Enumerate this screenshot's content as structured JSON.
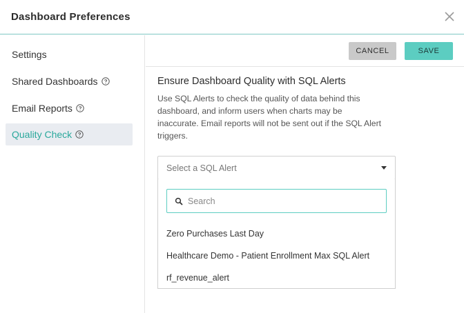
{
  "dialog": {
    "title": "Dashboard Preferences"
  },
  "sidebar": {
    "items": [
      {
        "label": "Settings",
        "has_help": false
      },
      {
        "label": "Shared Dashboards",
        "has_help": true
      },
      {
        "label": "Email Reports",
        "has_help": true
      },
      {
        "label": "Quality Check",
        "has_help": true,
        "active": true
      }
    ]
  },
  "toolbar": {
    "cancel_label": "CANCEL",
    "save_label": "SAVE"
  },
  "main": {
    "heading": "Ensure Dashboard Quality with SQL Alerts",
    "description": "Use SQL Alerts to check the quality of data behind this dashboard, and inform users when charts may be inaccurate. Email reports will not be sent out if the SQL Alert triggers.",
    "select": {
      "placeholder": "Select a SQL Alert",
      "search_placeholder": "Search",
      "options": [
        "Zero Purchases Last Day",
        "Healthcare Demo - Patient Enrollment Max SQL Alert",
        "rf_revenue_alert"
      ]
    }
  },
  "colors": {
    "accent": "#5ccdc1",
    "active_text": "#2aa89c",
    "active_bg": "#e9ecf1",
    "header_border": "#7fc8c3"
  },
  "icons": {
    "close": "close-icon",
    "help": "help-circle-icon",
    "caret": "caret-down-icon",
    "search": "search-icon"
  }
}
